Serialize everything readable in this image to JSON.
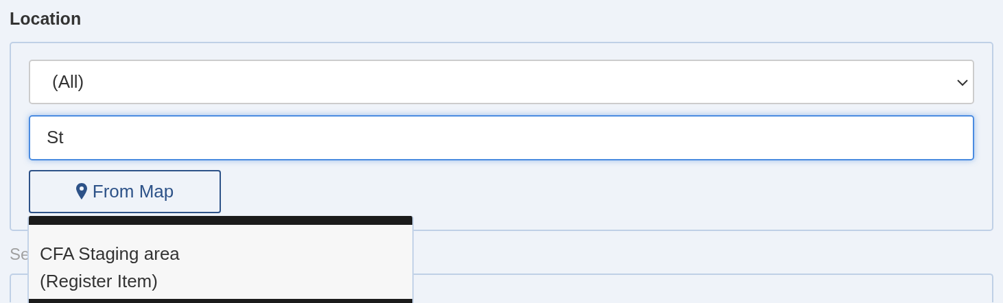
{
  "section_title": "Location",
  "location_select": {
    "value": "(All)"
  },
  "search_field": {
    "value": "St",
    "focused": true
  },
  "map_button": {
    "label": "From Map"
  },
  "suggestions": [
    {
      "label": "CFA Staging area\n(Register Item)",
      "selected": false
    }
  ],
  "next_label": {
    "text": "Se"
  }
}
